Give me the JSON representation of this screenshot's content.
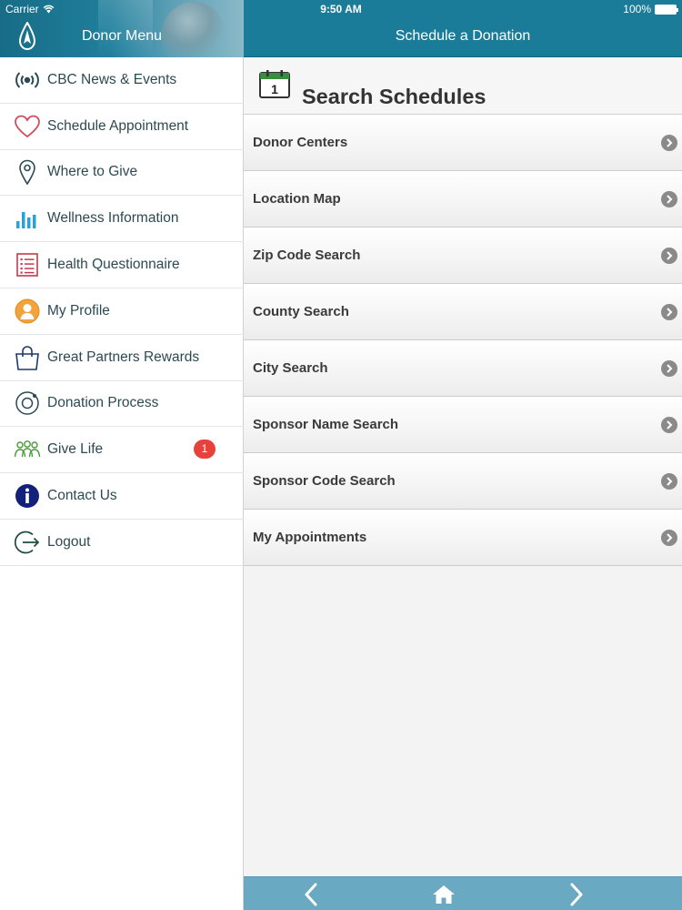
{
  "status_bar": {
    "carrier": "Carrier",
    "time": "9:50 AM",
    "battery": "100%"
  },
  "left_panel": {
    "title": "Donor Menu",
    "items": [
      {
        "label": "CBC News & Events",
        "icon": "broadcast-icon"
      },
      {
        "label": "Schedule Appointment",
        "icon": "heart-icon"
      },
      {
        "label": "Where to Give",
        "icon": "map-pin-icon"
      },
      {
        "label": "Wellness Information",
        "icon": "bar-chart-icon"
      },
      {
        "label": "Health Questionnaire",
        "icon": "checklist-icon"
      },
      {
        "label": "My Profile",
        "icon": "user-icon"
      },
      {
        "label": "Great Partners Rewards",
        "icon": "shopping-bag-icon"
      },
      {
        "label": "Donation Process",
        "icon": "process-icon"
      },
      {
        "label": "Give Life",
        "icon": "people-icon",
        "badge": "1"
      },
      {
        "label": "Contact Us",
        "icon": "info-icon"
      },
      {
        "label": "Logout",
        "icon": "logout-icon"
      }
    ]
  },
  "right_panel": {
    "title": "Schedule a Donation",
    "section_title": "Search Schedules",
    "calendar_day": "1",
    "items": [
      {
        "label": "Donor Centers"
      },
      {
        "label": "Location Map"
      },
      {
        "label": "Zip Code Search"
      },
      {
        "label": "County Search"
      },
      {
        "label": "City Search"
      },
      {
        "label": "Sponsor Name Search"
      },
      {
        "label": "Sponsor Code Search"
      },
      {
        "label": "My Appointments"
      }
    ]
  },
  "colors": {
    "header": "#1b7c99",
    "menu_text": "#2c4a52",
    "badge": "#e8413b",
    "bottom_bar": "#6aa9c2"
  }
}
